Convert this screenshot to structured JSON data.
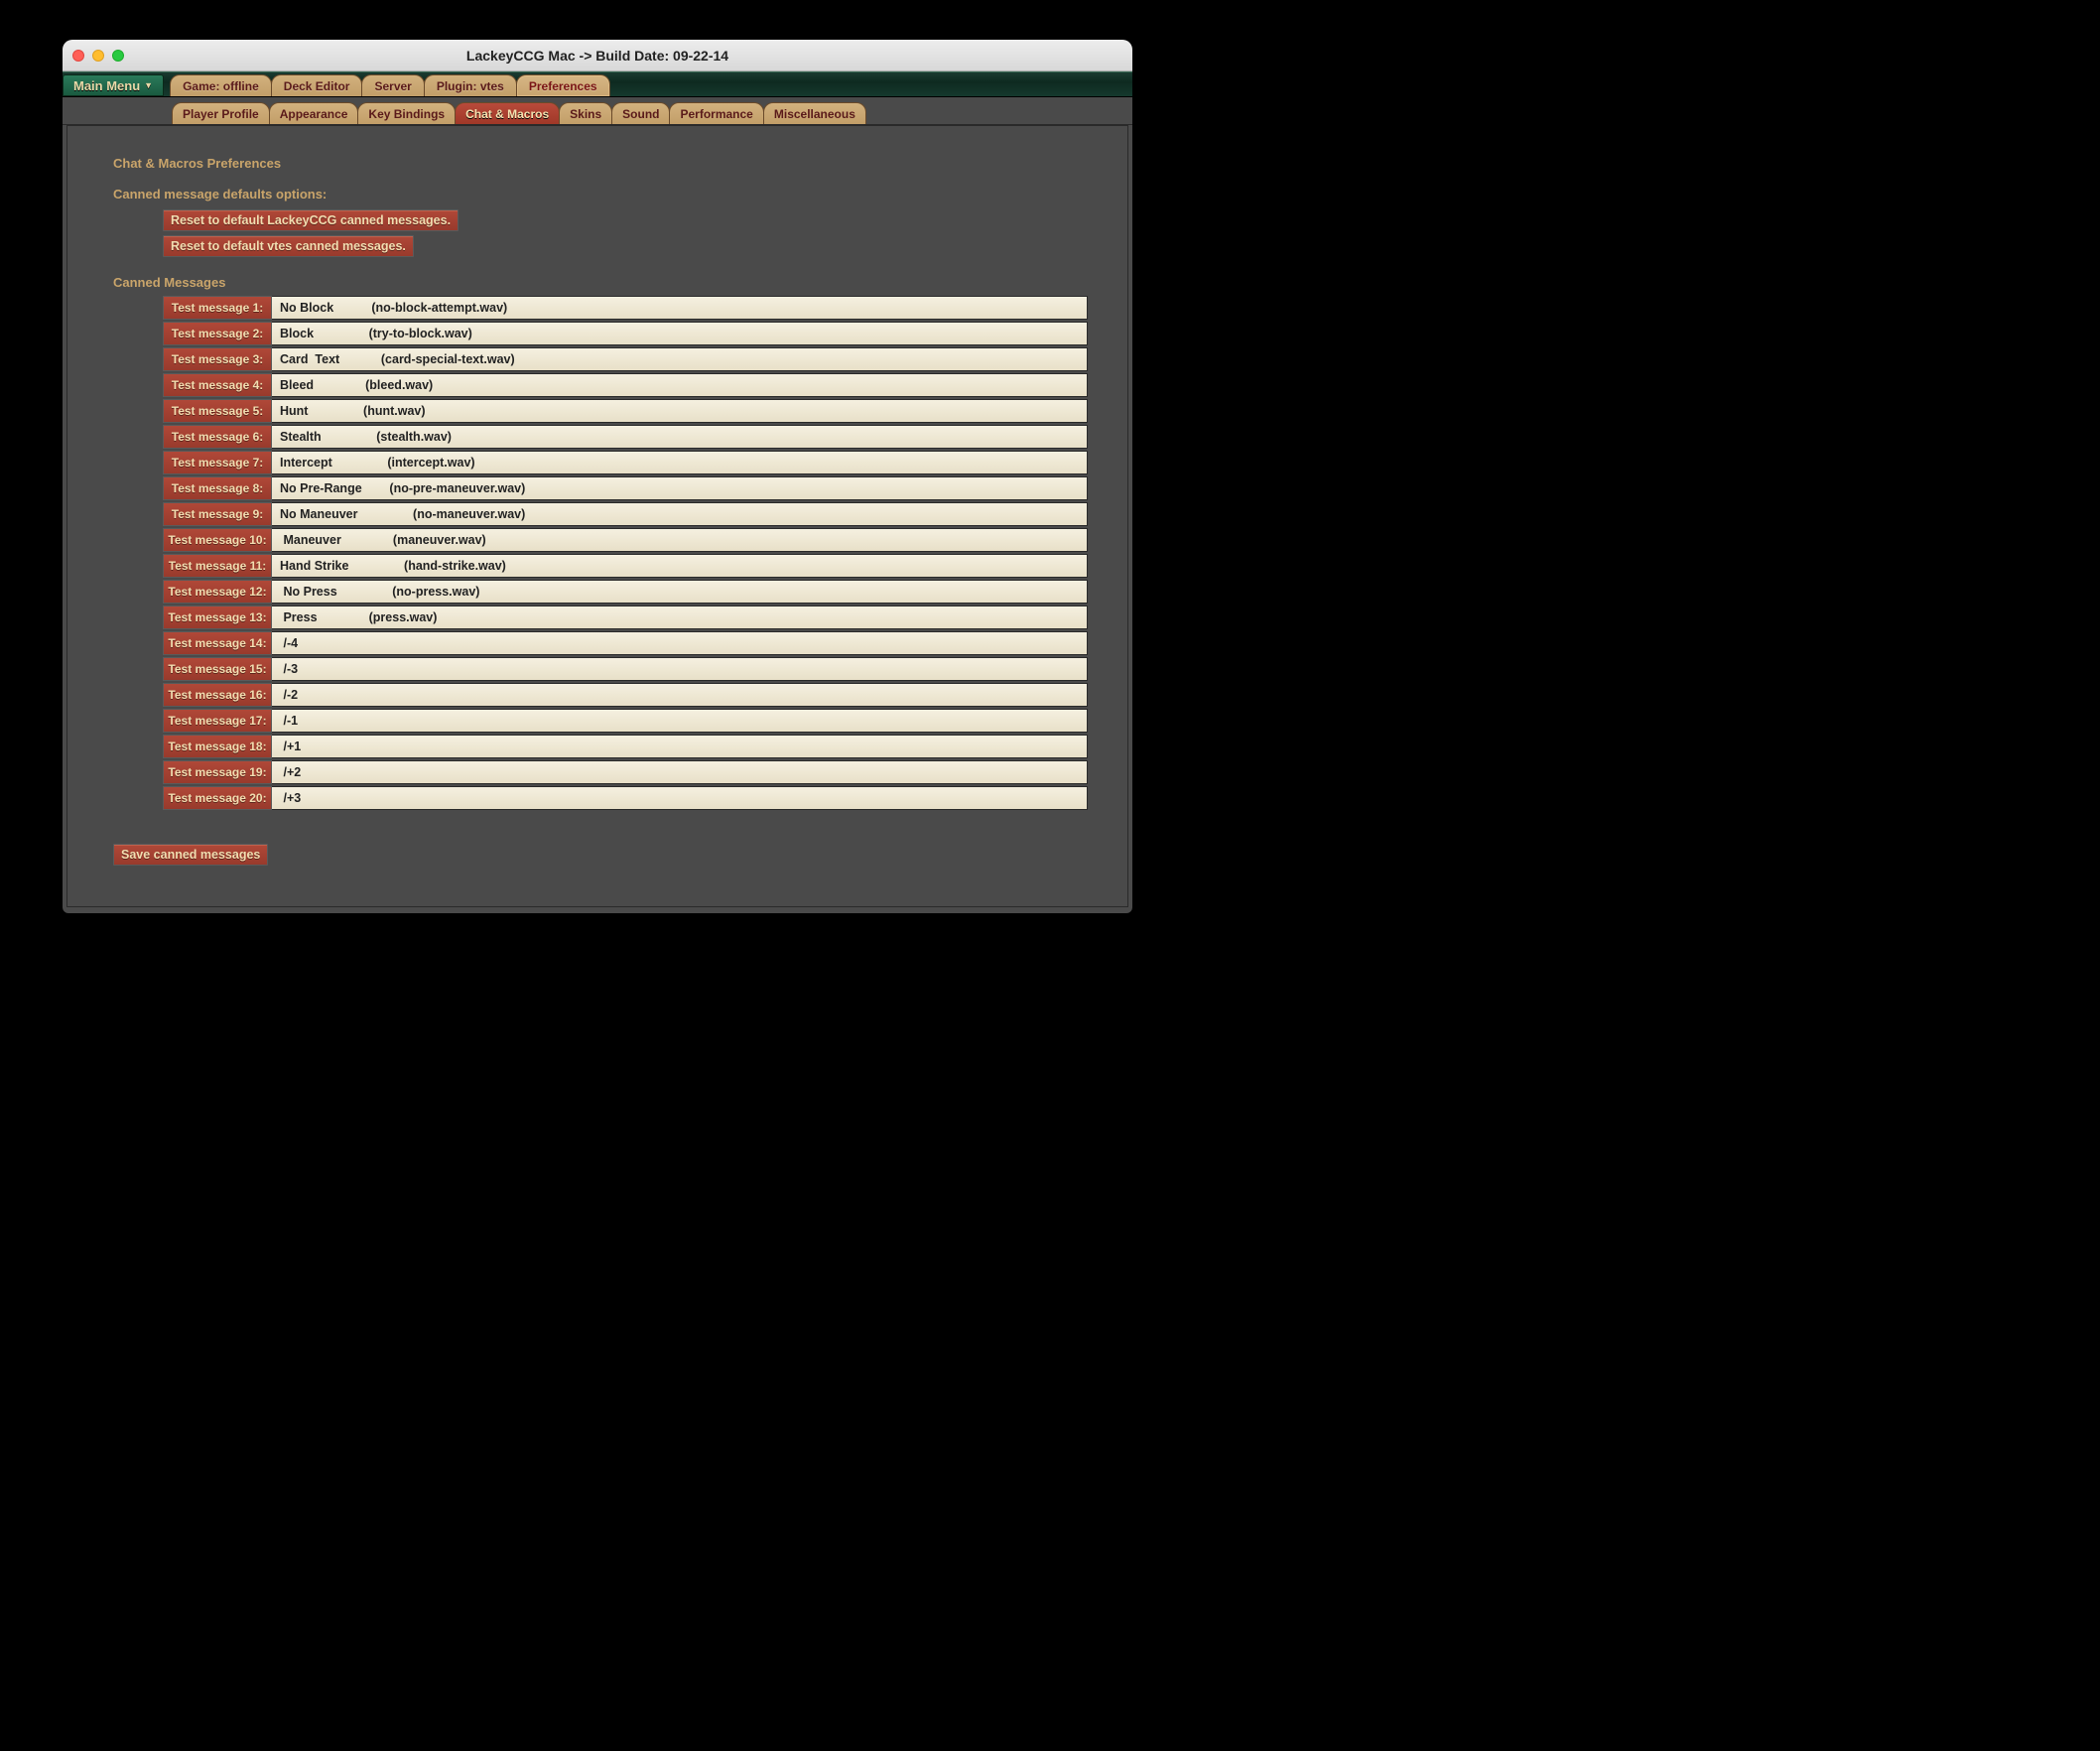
{
  "window": {
    "title": "LackeyCCG Mac -> Build Date: 09-22-14"
  },
  "main_menu_label": "Main Menu",
  "top_tabs": [
    {
      "label": "Game: offline"
    },
    {
      "label": "Deck Editor"
    },
    {
      "label": "Server"
    },
    {
      "label": "Plugin: vtes"
    },
    {
      "label": "Preferences",
      "active": true
    }
  ],
  "sub_tabs": [
    {
      "label": "Player Profile"
    },
    {
      "label": "Appearance"
    },
    {
      "label": "Key Bindings"
    },
    {
      "label": "Chat & Macros",
      "active": true
    },
    {
      "label": "Skins"
    },
    {
      "label": "Sound"
    },
    {
      "label": "Performance"
    },
    {
      "label": "Miscellaneous"
    }
  ],
  "headings": {
    "main": "Chat & Macros Preferences",
    "defaults": "Canned message defaults options:",
    "messages": "Canned Messages"
  },
  "buttons": {
    "reset_lackey": "Reset to default LackeyCCG canned messages.",
    "reset_vtes": "Reset to default vtes canned messages.",
    "save": "Save canned messages"
  },
  "messages": [
    {
      "label": "Test message 1:",
      "value": "No Block           (no-block-attempt.wav)"
    },
    {
      "label": "Test message 2:",
      "value": "Block                (try-to-block.wav)"
    },
    {
      "label": "Test message 3:",
      "value": "Card  Text            (card-special-text.wav)"
    },
    {
      "label": "Test message 4:",
      "value": "Bleed               (bleed.wav)"
    },
    {
      "label": "Test message 5:",
      "value": "Hunt                (hunt.wav)"
    },
    {
      "label": "Test message 6:",
      "value": "Stealth                (stealth.wav)"
    },
    {
      "label": "Test message 7:",
      "value": "Intercept                (intercept.wav)"
    },
    {
      "label": "Test message 8:",
      "value": "No Pre-Range        (no-pre-maneuver.wav)"
    },
    {
      "label": "Test message 9:",
      "value": "No Maneuver                (no-maneuver.wav)"
    },
    {
      "label": "Test message 10:",
      "value": " Maneuver               (maneuver.wav)"
    },
    {
      "label": "Test message 11:",
      "value": "Hand Strike                (hand-strike.wav)"
    },
    {
      "label": "Test message 12:",
      "value": " No Press                (no-press.wav)"
    },
    {
      "label": "Test message 13:",
      "value": " Press               (press.wav)"
    },
    {
      "label": "Test message 14:",
      "value": " /-4"
    },
    {
      "label": "Test message 15:",
      "value": " /-3"
    },
    {
      "label": "Test message 16:",
      "value": " /-2"
    },
    {
      "label": "Test message 17:",
      "value": " /-1"
    },
    {
      "label": "Test message 18:",
      "value": " /+1"
    },
    {
      "label": "Test message 19:",
      "value": " /+2"
    },
    {
      "label": "Test message 20:",
      "value": " /+3"
    }
  ]
}
